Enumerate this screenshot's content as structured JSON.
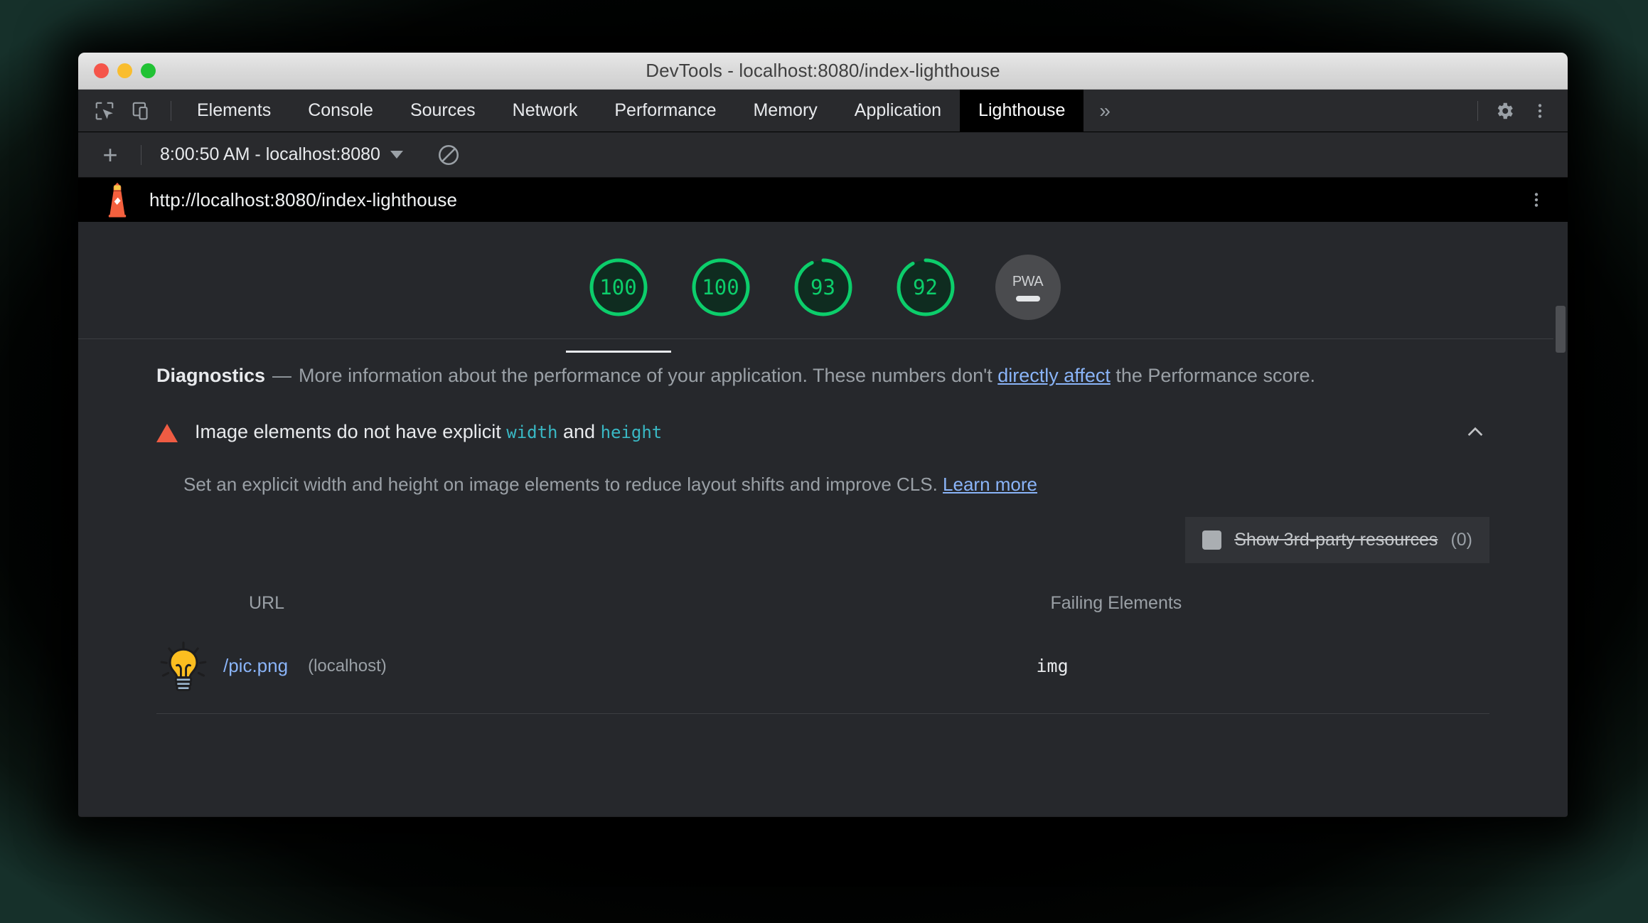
{
  "window": {
    "title": "DevTools - localhost:8080/index-lighthouse",
    "traffic_lights": [
      "close",
      "minimize",
      "zoom"
    ]
  },
  "devtools": {
    "icons": {
      "inspect": "inspect-element-icon",
      "device_toolbar": "device-toolbar-icon",
      "settings": "gear-icon",
      "more": "three-dot-menu-icon",
      "overflow_tabs": "»"
    },
    "tabs": [
      {
        "label": "Elements",
        "active": false
      },
      {
        "label": "Console",
        "active": false
      },
      {
        "label": "Sources",
        "active": false
      },
      {
        "label": "Network",
        "active": false
      },
      {
        "label": "Performance",
        "active": false
      },
      {
        "label": "Memory",
        "active": false
      },
      {
        "label": "Application",
        "active": false
      },
      {
        "label": "Lighthouse",
        "active": true
      }
    ]
  },
  "lighthouse_toolbar": {
    "new_report_label": "+",
    "selected_report": "8:00:50 AM - localhost:8080",
    "clear_icon": "no-entry-clear-icon"
  },
  "report": {
    "url": "http://localhost:8080/index-lighthouse",
    "menu_icon": "three-dot-menu-icon",
    "accent_green": "#0cce6b",
    "gauges": [
      {
        "category": "Performance",
        "score": "100",
        "value": 100,
        "selected": true
      },
      {
        "category": "Accessibility",
        "score": "100",
        "value": 100,
        "selected": false
      },
      {
        "category": "Best Practices",
        "score": "93",
        "value": 93,
        "selected": false
      },
      {
        "category": "SEO",
        "score": "92",
        "value": 92,
        "selected": false
      }
    ],
    "pwa": {
      "label": "PWA",
      "state": "not-applicable-dash"
    }
  },
  "diagnostics": {
    "title": "Diagnostics",
    "dash": "—",
    "text_before_link": "More information about the performance of your application. These numbers don't ",
    "link_text": "directly affect",
    "text_after_link": " the Performance score."
  },
  "audit": {
    "warning_icon": "warning-triangle-icon",
    "title_part1": "Image elements do not have explicit ",
    "code_width": "width",
    "title_and": " and ",
    "code_height": "height",
    "toggle_icon": "chevron-up-icon",
    "description_before_link": "Set an explicit width and height on image elements to reduce layout shifts and improve CLS. ",
    "learn_more": "Learn more",
    "third_party": {
      "checkbox_state": "unchecked-disabled",
      "label": "Show 3rd-party resources",
      "count": "(0)"
    },
    "table": {
      "columns": [
        "URL",
        "Failing Elements"
      ],
      "rows": [
        {
          "favicon": "lightbulb-favicon",
          "url": "/pic.png",
          "host": "(localhost)",
          "failing_element": "img"
        }
      ]
    }
  },
  "scrollbar": {
    "orientation": "vertical"
  }
}
